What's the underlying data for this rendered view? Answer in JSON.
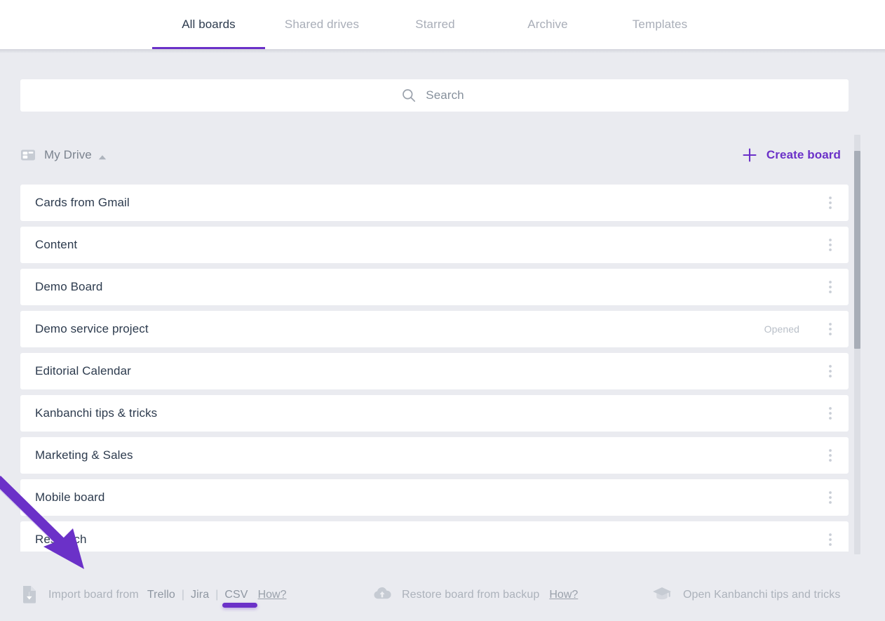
{
  "app": {
    "name": "Kanbanchi",
    "accent_purple": "#6b31c8",
    "page_background": "#eaebf0",
    "row_background": "#ffffff",
    "text_primary": "#2d3b4e",
    "text_muted": "#a9aeb8"
  },
  "tabs": [
    {
      "label": "All boards",
      "active": true,
      "name": "tab-all-boards"
    },
    {
      "label": "Shared drives",
      "active": false,
      "name": "tab-shared-drives"
    },
    {
      "label": "Starred",
      "active": false,
      "name": "tab-starred"
    },
    {
      "label": "Archive",
      "active": false,
      "name": "tab-archive"
    },
    {
      "label": "Templates",
      "active": false,
      "name": "tab-templates"
    }
  ],
  "search": {
    "placeholder": "Search",
    "value": "",
    "icon": "search-icon"
  },
  "drive": {
    "label": "My Drive",
    "icon": "board-grid-icon",
    "collapse_caret": "chevron-up-icon",
    "expanded": true
  },
  "create_board": {
    "label": "Create board",
    "icon": "plus-icon",
    "color": "#6b31c8"
  },
  "boards": [
    {
      "name": "Cards from Gmail",
      "status": ""
    },
    {
      "name": "Content",
      "status": ""
    },
    {
      "name": "Demo Board",
      "status": ""
    },
    {
      "name": "Demo service project",
      "status": "Opened"
    },
    {
      "name": "Editorial Calendar",
      "status": ""
    },
    {
      "name": "Kanbanchi tips & tricks",
      "status": ""
    },
    {
      "name": "Marketing & Sales",
      "status": ""
    },
    {
      "name": "Mobile board",
      "status": ""
    },
    {
      "name": "Research",
      "status": ""
    }
  ],
  "row_menu": {
    "icon": "more-vertical-icon",
    "label": "Board actions"
  },
  "scrollbar": {
    "orientation": "vertical",
    "thumb_position_percent": 4,
    "thumb_size_percent": 47
  },
  "bottom_bar": {
    "import": {
      "icon": "file-import-icon",
      "label": "Import board from",
      "sources": [
        {
          "label": "Trello",
          "highlighted": false
        },
        {
          "label": "Jira",
          "highlighted": false
        },
        {
          "label": "CSV",
          "highlighted": true
        }
      ],
      "separator": "|",
      "how_label": "How?"
    },
    "restore": {
      "icon": "cloud-upload-icon",
      "label": "Restore board from backup",
      "how_label": "How?"
    },
    "tips": {
      "icon": "graduation-cap-icon",
      "label": "Open Kanbanchi tips and tricks"
    }
  },
  "annotation": {
    "type": "arrow",
    "color": "#6b31c8",
    "points_to": "import-board-from",
    "name": "purple-arrow-annotation"
  }
}
